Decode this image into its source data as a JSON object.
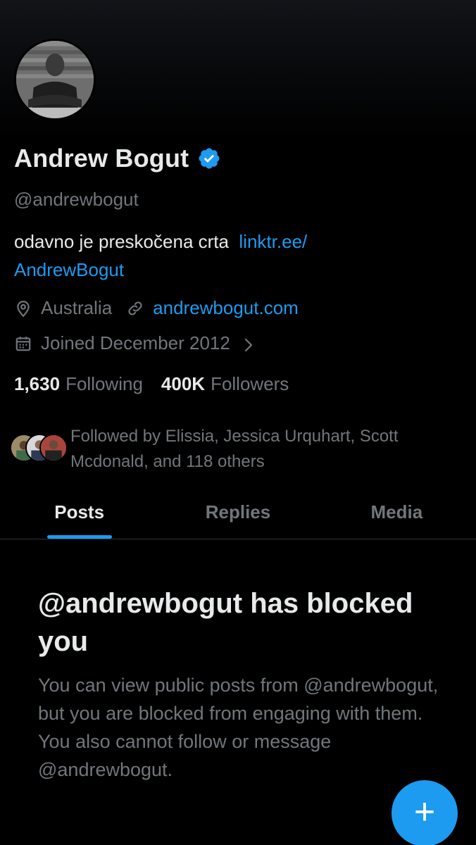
{
  "profile": {
    "display_name": "Andrew Bogut",
    "handle": "@andrewbogut",
    "bio_text": "odavno je preskočena crta",
    "bio_link_line1": "linktr.ee/",
    "bio_link_line2": "AndrewBogut",
    "location": "Australia",
    "website": "andrewbogut.com",
    "joined": "Joined December 2012",
    "following_count": "1,630",
    "following_label": "Following",
    "followers_count": "400K",
    "followers_label": "Followers",
    "followed_by": "Followed by Elissia, Jessica Urquhart, Scott Mcdonald, and 118 others"
  },
  "tabs": [
    {
      "label": "Posts",
      "active": true
    },
    {
      "label": "Replies",
      "active": false
    },
    {
      "label": "Media",
      "active": false
    }
  ],
  "blocked": {
    "title": "@andrewbogut has blocked you",
    "description": "You can view public posts from @andrewbogut, but you are blocked from engaging with them. You also cannot follow or message @andrewbogut."
  },
  "fab": {
    "icon": "plus-icon",
    "label": "+"
  },
  "colors": {
    "background": "#000000",
    "primary_text": "#e7e9ea",
    "secondary_text": "#71767b",
    "accent": "#1d9bf0",
    "divider": "#2f3336"
  },
  "icons": {
    "verified": "verified-badge-icon",
    "location": "location-pin-icon",
    "link": "link-icon",
    "calendar": "calendar-icon",
    "chevron": "chevron-right-icon"
  }
}
